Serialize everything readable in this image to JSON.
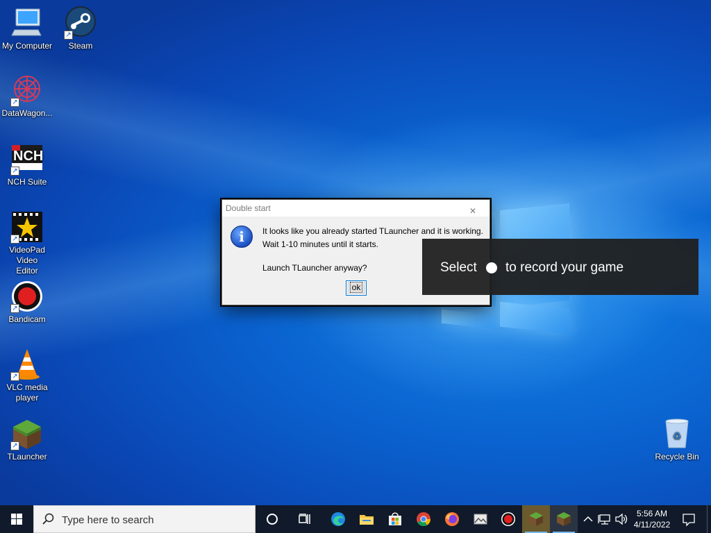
{
  "desktop": {
    "icons": [
      {
        "label": "My Computer",
        "icon": "computer-icon"
      },
      {
        "label": "Steam",
        "icon": "steam-icon"
      },
      {
        "label": "DataWagon...",
        "icon": "datawagon-icon"
      },
      {
        "label": "NCH Suite",
        "icon": "nch-icon"
      },
      {
        "label": "VideoPad Video Editor",
        "icon": "videopad-icon"
      },
      {
        "label": "Bandicam",
        "icon": "bandicam-icon"
      },
      {
        "label": "VLC media player",
        "icon": "vlc-icon"
      },
      {
        "label": "TLauncher",
        "icon": "minecraft-icon"
      },
      {
        "label": "Recycle Bin",
        "icon": "recycle-bin-icon"
      }
    ]
  },
  "dialog": {
    "title": "Double start",
    "line1": "It looks like you already started TLauncher and it is working.",
    "line2": "Wait 1-10 minutes until it starts.",
    "line3": "Launch TLauncher anyway?",
    "ok_label": "ok"
  },
  "toast": {
    "prefix": "Select",
    "suffix": "to record your game"
  },
  "taskbar": {
    "search_placeholder": "Type here to search",
    "apps": [
      "cortana-icon",
      "task-view-icon",
      "edge-icon",
      "file-explorer-icon",
      "store-icon",
      "chrome-icon",
      "firefox-icon",
      "photos-icon",
      "bandicam-icon",
      "minecraft-icon",
      "minecraft-icon"
    ],
    "time": "5:56 AM",
    "date": "4/11/2022"
  },
  "colors": {
    "taskbar_bg": "#101a2a",
    "toast_bg": "#202020",
    "accent": "#0078d7"
  }
}
